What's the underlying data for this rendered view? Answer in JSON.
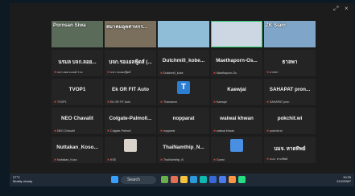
{
  "window": {
    "controls": [
      "⤢",
      "×"
    ]
  },
  "tiles": [
    {
      "name": "Pornsan Siwa",
      "video": true,
      "sub": ""
    },
    {
      "name": "สมาคมอุตสาหกร...",
      "video": true,
      "sub": ""
    },
    {
      "name": "",
      "video": true,
      "sub": ""
    },
    {
      "name": "",
      "video": true,
      "sub": "",
      "active": true
    },
    {
      "name": "ZK Siam",
      "video": true,
      "sub": ""
    },
    {
      "name": "นรมล บจก.ลอย...",
      "video": false,
      "sub": "บจก.ลอย แอนด์ ร่วม"
    },
    {
      "name": "บจก.รอแยลฟู้ดส์ (...",
      "video": false,
      "sub": "บจก.รอแยลฟู้ดส์"
    },
    {
      "name": "Dutchmill_kobe...",
      "video": false,
      "sub": "Dutchmill_kobe"
    },
    {
      "name": "Maethaporn-Os...",
      "video": false,
      "sub": "Maethaporn-Os"
    },
    {
      "name": "ธาลพา",
      "video": false,
      "sub": "ธาลพา"
    },
    {
      "name": "TVOP1",
      "video": false,
      "sub": "TVOP1"
    },
    {
      "name": "Ek OR FIT Auto",
      "video": false,
      "sub": "Ek OR FIT Auto"
    },
    {
      "name": "",
      "video": false,
      "avatar": "T",
      "sub": "Thanakorn"
    },
    {
      "name": "Kaewjai",
      "video": false,
      "sub": "Kaewjai"
    },
    {
      "name": "SAHAPAT pron...",
      "video": false,
      "sub": "SAHAPAT pron"
    },
    {
      "name": "NEO Chavalit",
      "video": false,
      "sub": "NEO Chavalit"
    },
    {
      "name": "Colgate-Palmoll...",
      "video": false,
      "sub": "Colgate-Palmoll"
    },
    {
      "name": "nopparat",
      "video": false,
      "sub": "nopparat"
    },
    {
      "name": "waiwai khwan",
      "video": false,
      "sub": "waiwai khwan"
    },
    {
      "name": "pokchit.wi",
      "video": false,
      "sub": "pokchit.wi"
    },
    {
      "name": "Nuttakan_Koso...",
      "video": false,
      "sub": "Nuttakan_Koso"
    },
    {
      "name": "",
      "video": false,
      "avatar": "person-photo",
      "sub": "KSE"
    },
    {
      "name": "ThaiNamthip_N...",
      "video": false,
      "sub": "ThaiNamthip_N"
    },
    {
      "name": "",
      "video": false,
      "avatar": "person-icon",
      "sub": "Guest"
    },
    {
      "name": "บมจ. หาดทิพย์",
      "video": false,
      "sub": "บมจ. หาดทิพย์"
    }
  ],
  "taskbar": {
    "weather": [
      "27°C",
      "Mostly cloudy"
    ],
    "search_label": "Search",
    "clock": [
      "10:25",
      "21/2/2567"
    ]
  }
}
